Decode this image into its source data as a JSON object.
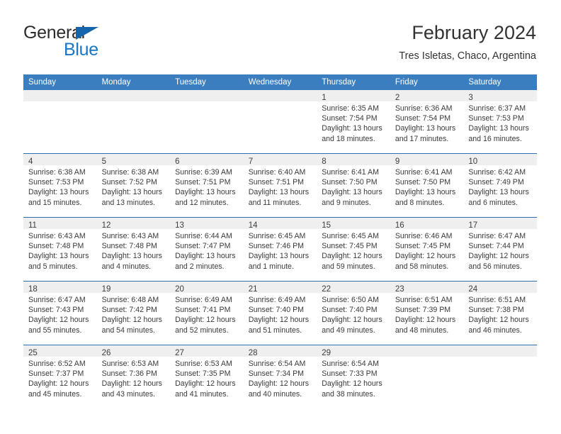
{
  "brand": {
    "name_part1": "General",
    "name_part2": "Blue",
    "triangle_color": "#1565ad",
    "blue_color": "#1877c9"
  },
  "header": {
    "title": "February 2024",
    "subtitle": "Tres Isletas, Chaco, Argentina"
  },
  "theme": {
    "header_row_bg": "#3a7ec0",
    "row_separator": "#2f6fb0",
    "day_band_bg": "#efefef",
    "text_color": "#3a3a3a"
  },
  "weekday_headers": [
    "Sunday",
    "Monday",
    "Tuesday",
    "Wednesday",
    "Thursday",
    "Friday",
    "Saturday"
  ],
  "weeks": [
    [
      {
        "day": "",
        "lines": []
      },
      {
        "day": "",
        "lines": []
      },
      {
        "day": "",
        "lines": []
      },
      {
        "day": "",
        "lines": []
      },
      {
        "day": "1",
        "lines": [
          "Sunrise: 6:35 AM",
          "Sunset: 7:54 PM",
          "Daylight: 13 hours",
          "and 18 minutes."
        ]
      },
      {
        "day": "2",
        "lines": [
          "Sunrise: 6:36 AM",
          "Sunset: 7:54 PM",
          "Daylight: 13 hours",
          "and 17 minutes."
        ]
      },
      {
        "day": "3",
        "lines": [
          "Sunrise: 6:37 AM",
          "Sunset: 7:53 PM",
          "Daylight: 13 hours",
          "and 16 minutes."
        ]
      }
    ],
    [
      {
        "day": "4",
        "lines": [
          "Sunrise: 6:38 AM",
          "Sunset: 7:53 PM",
          "Daylight: 13 hours",
          "and 15 minutes."
        ]
      },
      {
        "day": "5",
        "lines": [
          "Sunrise: 6:38 AM",
          "Sunset: 7:52 PM",
          "Daylight: 13 hours",
          "and 13 minutes."
        ]
      },
      {
        "day": "6",
        "lines": [
          "Sunrise: 6:39 AM",
          "Sunset: 7:51 PM",
          "Daylight: 13 hours",
          "and 12 minutes."
        ]
      },
      {
        "day": "7",
        "lines": [
          "Sunrise: 6:40 AM",
          "Sunset: 7:51 PM",
          "Daylight: 13 hours",
          "and 11 minutes."
        ]
      },
      {
        "day": "8",
        "lines": [
          "Sunrise: 6:41 AM",
          "Sunset: 7:50 PM",
          "Daylight: 13 hours",
          "and 9 minutes."
        ]
      },
      {
        "day": "9",
        "lines": [
          "Sunrise: 6:41 AM",
          "Sunset: 7:50 PM",
          "Daylight: 13 hours",
          "and 8 minutes."
        ]
      },
      {
        "day": "10",
        "lines": [
          "Sunrise: 6:42 AM",
          "Sunset: 7:49 PM",
          "Daylight: 13 hours",
          "and 6 minutes."
        ]
      }
    ],
    [
      {
        "day": "11",
        "lines": [
          "Sunrise: 6:43 AM",
          "Sunset: 7:48 PM",
          "Daylight: 13 hours",
          "and 5 minutes."
        ]
      },
      {
        "day": "12",
        "lines": [
          "Sunrise: 6:43 AM",
          "Sunset: 7:48 PM",
          "Daylight: 13 hours",
          "and 4 minutes."
        ]
      },
      {
        "day": "13",
        "lines": [
          "Sunrise: 6:44 AM",
          "Sunset: 7:47 PM",
          "Daylight: 13 hours",
          "and 2 minutes."
        ]
      },
      {
        "day": "14",
        "lines": [
          "Sunrise: 6:45 AM",
          "Sunset: 7:46 PM",
          "Daylight: 13 hours",
          "and 1 minute."
        ]
      },
      {
        "day": "15",
        "lines": [
          "Sunrise: 6:45 AM",
          "Sunset: 7:45 PM",
          "Daylight: 12 hours",
          "and 59 minutes."
        ]
      },
      {
        "day": "16",
        "lines": [
          "Sunrise: 6:46 AM",
          "Sunset: 7:45 PM",
          "Daylight: 12 hours",
          "and 58 minutes."
        ]
      },
      {
        "day": "17",
        "lines": [
          "Sunrise: 6:47 AM",
          "Sunset: 7:44 PM",
          "Daylight: 12 hours",
          "and 56 minutes."
        ]
      }
    ],
    [
      {
        "day": "18",
        "lines": [
          "Sunrise: 6:47 AM",
          "Sunset: 7:43 PM",
          "Daylight: 12 hours",
          "and 55 minutes."
        ]
      },
      {
        "day": "19",
        "lines": [
          "Sunrise: 6:48 AM",
          "Sunset: 7:42 PM",
          "Daylight: 12 hours",
          "and 54 minutes."
        ]
      },
      {
        "day": "20",
        "lines": [
          "Sunrise: 6:49 AM",
          "Sunset: 7:41 PM",
          "Daylight: 12 hours",
          "and 52 minutes."
        ]
      },
      {
        "day": "21",
        "lines": [
          "Sunrise: 6:49 AM",
          "Sunset: 7:40 PM",
          "Daylight: 12 hours",
          "and 51 minutes."
        ]
      },
      {
        "day": "22",
        "lines": [
          "Sunrise: 6:50 AM",
          "Sunset: 7:40 PM",
          "Daylight: 12 hours",
          "and 49 minutes."
        ]
      },
      {
        "day": "23",
        "lines": [
          "Sunrise: 6:51 AM",
          "Sunset: 7:39 PM",
          "Daylight: 12 hours",
          "and 48 minutes."
        ]
      },
      {
        "day": "24",
        "lines": [
          "Sunrise: 6:51 AM",
          "Sunset: 7:38 PM",
          "Daylight: 12 hours",
          "and 46 minutes."
        ]
      }
    ],
    [
      {
        "day": "25",
        "lines": [
          "Sunrise: 6:52 AM",
          "Sunset: 7:37 PM",
          "Daylight: 12 hours",
          "and 45 minutes."
        ]
      },
      {
        "day": "26",
        "lines": [
          "Sunrise: 6:53 AM",
          "Sunset: 7:36 PM",
          "Daylight: 12 hours",
          "and 43 minutes."
        ]
      },
      {
        "day": "27",
        "lines": [
          "Sunrise: 6:53 AM",
          "Sunset: 7:35 PM",
          "Daylight: 12 hours",
          "and 41 minutes."
        ]
      },
      {
        "day": "28",
        "lines": [
          "Sunrise: 6:54 AM",
          "Sunset: 7:34 PM",
          "Daylight: 12 hours",
          "and 40 minutes."
        ]
      },
      {
        "day": "29",
        "lines": [
          "Sunrise: 6:54 AM",
          "Sunset: 7:33 PM",
          "Daylight: 12 hours",
          "and 38 minutes."
        ]
      },
      {
        "day": "",
        "lines": []
      },
      {
        "day": "",
        "lines": []
      }
    ]
  ]
}
